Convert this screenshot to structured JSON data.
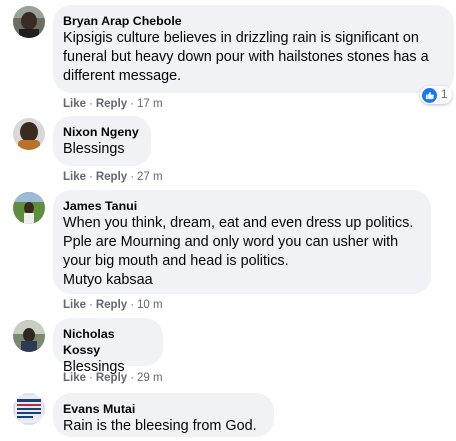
{
  "comments": [
    {
      "author": "Bryan Arap Chebole",
      "text": "Kipsigis culture believes in drizzling rain is significant on funeral but heavy down pour with hailstones stones has a different message.",
      "like": "Like",
      "reply": "Reply",
      "time": "17 m",
      "reaction_count": "1"
    },
    {
      "author": "Nixon Ngeny",
      "text": "Blessings",
      "like": "Like",
      "reply": "Reply",
      "time": "27 m"
    },
    {
      "author": "James Tanui",
      "text": "When you think, dream, eat and even dress up politics. Pple are Mourning and only word you can usher with your big mouth and head is politics.",
      "text2": "Mutyo kabsaa",
      "like": "Like",
      "reply": "Reply",
      "time": "10 m"
    },
    {
      "author": "Nicholas Kossy",
      "text": "Blessings",
      "like": "Like",
      "reply": "Reply",
      "time": "29 m"
    },
    {
      "author": "Evans Mutai",
      "text": "Rain is the bleesing from God."
    }
  ],
  "colors": {
    "bubble": "#f0f2f5",
    "meta": "#65676b",
    "like_blue": "#1877f2"
  },
  "icons": {
    "reaction": "thumbs-up-icon"
  }
}
